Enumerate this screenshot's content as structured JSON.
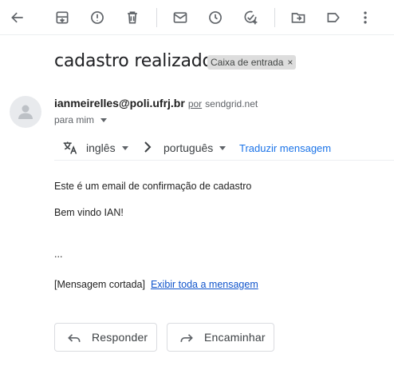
{
  "toolbar": {
    "icons": [
      "back-icon",
      "archive-icon",
      "report-spam-icon",
      "delete-icon",
      "mark-unread-icon",
      "snooze-icon",
      "add-to-tasks-icon",
      "move-to-icon",
      "labels-icon",
      "more-icon"
    ]
  },
  "email": {
    "subject": "cadastro realizado",
    "label": "Caixa de entrada",
    "label_close": "×",
    "sender_name": "ianmeirelles@poli.ufrj.br",
    "via_text": "por",
    "via_domain": "sendgrid.net",
    "to_text": "para mim"
  },
  "translate": {
    "from_lang": "inglês",
    "to_lang": "português",
    "link": "Traduzir mensagem"
  },
  "body": {
    "line1": "Este é um email de confirmação de cadastro",
    "line2": "Bem vindo IAN!",
    "ellipsis": "...",
    "clipped_text": "[Mensagem cortada]",
    "clipped_link": "Exibir toda a mensagem"
  },
  "actions": {
    "reply": "Responder",
    "forward": "Encaminhar"
  }
}
